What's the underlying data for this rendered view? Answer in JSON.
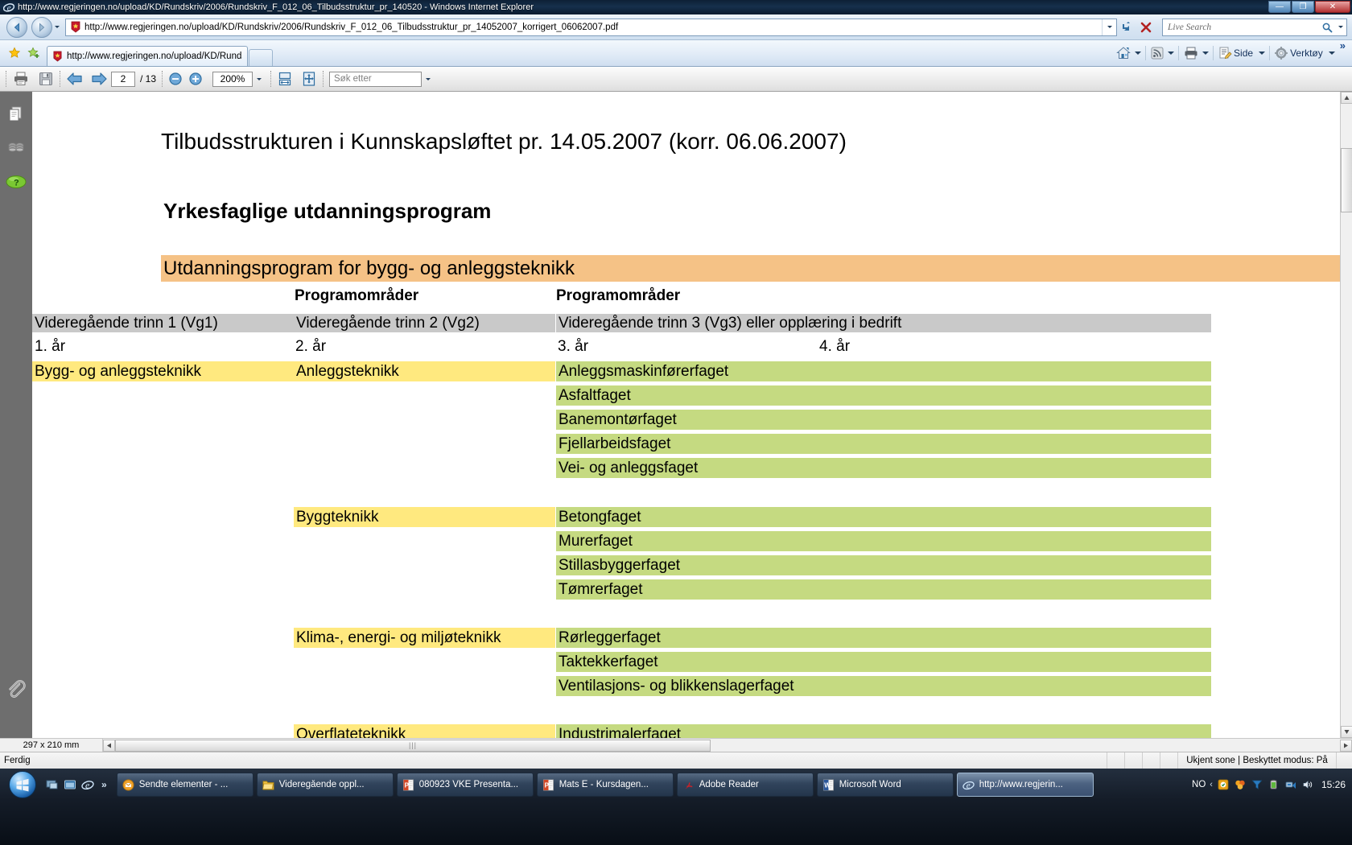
{
  "window": {
    "title": "http://www.regjeringen.no/upload/KD/Rundskriv/2006/Rundskriv_F_012_06_Tilbudsstruktur_pr_140520 - Windows Internet Explorer",
    "minimize_label": "—",
    "maximize_label": "❐",
    "close_label": "✕"
  },
  "browser": {
    "url": "http://www.regjeringen.no/upload/KD/Rundskriv/2006/Rundskriv_F_012_06_Tilbudsstruktur_pr_14052007_korrigert_06062007.pdf",
    "search_placeholder": "Live Search",
    "tab_label": "http://www.regjeringen.no/upload/KD/Rundskri...",
    "commands": {
      "page_label": "Side",
      "tools_label": "Verktøy",
      "overflow_label": "»"
    }
  },
  "pdf_toolbar": {
    "page_current": "2",
    "page_total": "/ 13",
    "zoom_value": "200%",
    "find_placeholder": "Søk etter"
  },
  "sidebar": {
    "items": [
      {
        "name": "pages-panel-icon",
        "label": "Sider"
      },
      {
        "name": "layers-panel-icon",
        "label": "Lag"
      },
      {
        "name": "help-panel-icon",
        "label": "Hjelp"
      },
      {
        "name": "attachments-panel-icon",
        "label": "Vedlegg"
      }
    ]
  },
  "document": {
    "title": "Tilbudsstrukturen i Kunnskapsløftet pr. 14.05.2007 (korr. 06.06.2007)",
    "heading": "Yrkesfaglige utdanningsprogram",
    "program_banner": "Utdanningsprogram for bygg- og anleggsteknikk",
    "col_headers": {
      "vg2_programomrader": "Programområder",
      "vg3_programomrader": "Programområder",
      "vg1": "Videregående trinn 1 (Vg1)",
      "vg2": "Videregående trinn 2 (Vg2)",
      "vg3": "Videregående trinn 3 (Vg3) eller opplæring i bedrift",
      "year1": "1. år",
      "year2": "2. år",
      "year3": "3. år",
      "year4": "4. år"
    },
    "vg1_program": "Bygg- og anleggsteknikk",
    "groups": [
      {
        "vg2": "Anleggsteknikk",
        "vg3": [
          "Anleggsmaskinførerfaget",
          "Asfaltfaget",
          "Banemontørfaget",
          "Fjellarbeidsfaget",
          "Vei- og anleggsfaget"
        ]
      },
      {
        "vg2": "Byggteknikk",
        "vg3": [
          "Betongfaget",
          "Murerfaget",
          "Stillasbyggerfaget",
          "Tømrerfaget"
        ]
      },
      {
        "vg2": "Klima-, energi- og miljøteknikk",
        "vg3": [
          "Rørleggerfaget",
          "Taktekkerfaget",
          "Ventilasjons- og blikkenslagerfaget"
        ]
      },
      {
        "vg2": "Overflateteknikk",
        "vg3": [
          "Industrimalerfaget"
        ]
      }
    ]
  },
  "pdf_status": {
    "page_size": "297 x 210 mm"
  },
  "ie_status": {
    "ready": "Ferdig",
    "zone": "Ukjent sone | Beskyttet modus: På"
  },
  "taskbar": {
    "start_label": "Start",
    "quicklaunch_overflow": "»",
    "buttons": [
      {
        "label": "Sendte elementer - ...",
        "icon": "outlook-icon",
        "active": false
      },
      {
        "label": "Videregående oppl...",
        "icon": "folder-icon",
        "active": false
      },
      {
        "label": "080923 VKE Presenta...",
        "icon": "powerpoint-icon",
        "active": false
      },
      {
        "label": "Mats E - Kursdagen...",
        "icon": "powerpoint-icon",
        "active": false
      },
      {
        "label": "Adobe Reader",
        "icon": "acrobat-icon",
        "active": false
      },
      {
        "label": "Microsoft Word",
        "icon": "word-icon",
        "active": false
      },
      {
        "label": "http://www.regjerin...",
        "icon": "ie-icon",
        "active": true
      }
    ],
    "language": "NO",
    "tray_chevron": "‹",
    "clock": "15:26"
  },
  "colors": {
    "banner_orange": "#f5c286",
    "header_gray": "#c9c9c9",
    "vg2_yellow": "#ffe97f",
    "vg3_green": "#c5da81"
  }
}
